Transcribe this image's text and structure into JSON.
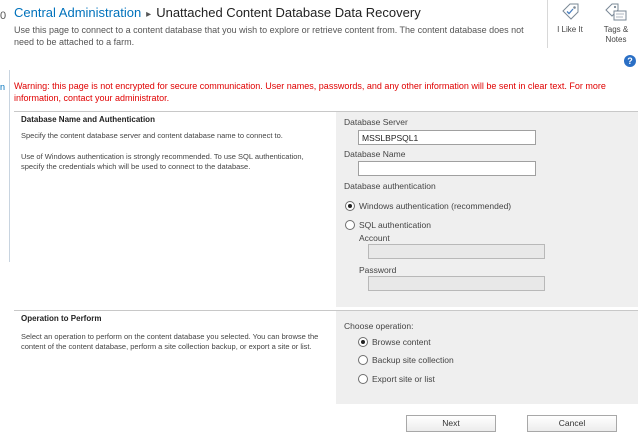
{
  "left_cut": {
    "top_char": "0",
    "link_char": "n"
  },
  "breadcrumb": {
    "root": "Central Administration",
    "separator": "▸",
    "current": "Unattached Content Database Data Recovery"
  },
  "description": "Use this page to connect to a content database that you wish to explore or retrieve content from. The content database does not need to be attached to a farm.",
  "ribbon": {
    "like": {
      "label": "I Like It",
      "icon": "like-tag-icon"
    },
    "tags": {
      "label": "Tags & Notes",
      "icon": "tag-note-icon"
    }
  },
  "help_icon": {
    "glyph": "?",
    "icon": "help-icon"
  },
  "warning": "Warning: this page is not encrypted for secure communication. User names, passwords, and any other information will be sent in clear text. For more information, contact your administrator.",
  "db_section": {
    "title": "Database Name and Authentication",
    "text1": "Specify the content database server and content database name to connect to.",
    "text2": "Use of Windows authentication is strongly recommended. To use SQL authentication, specify the credentials which will be used to connect to the database.",
    "server_label": "Database Server",
    "server_value": "MSSLBPSQL1",
    "name_label": "Database Name",
    "name_value": "",
    "auth_label": "Database authentication",
    "windows_auth": "Windows authentication (recommended)",
    "sql_auth": "SQL authentication",
    "account_label": "Account",
    "password_label": "Password"
  },
  "op_section": {
    "title": "Operation to Perform",
    "text": "Select an operation to perform on the content database you selected. You can browse the content of the content database, perform a site collection backup, or export a site or list.",
    "choose_label": "Choose operation:",
    "options": [
      "Browse content",
      "Backup site collection",
      "Export site or list"
    ],
    "selected": "Browse content"
  },
  "buttons": {
    "next": "Next",
    "cancel": "Cancel"
  },
  "colors": {
    "link": "#0072bc",
    "warning": "#e00000",
    "panel": "#efefef"
  }
}
